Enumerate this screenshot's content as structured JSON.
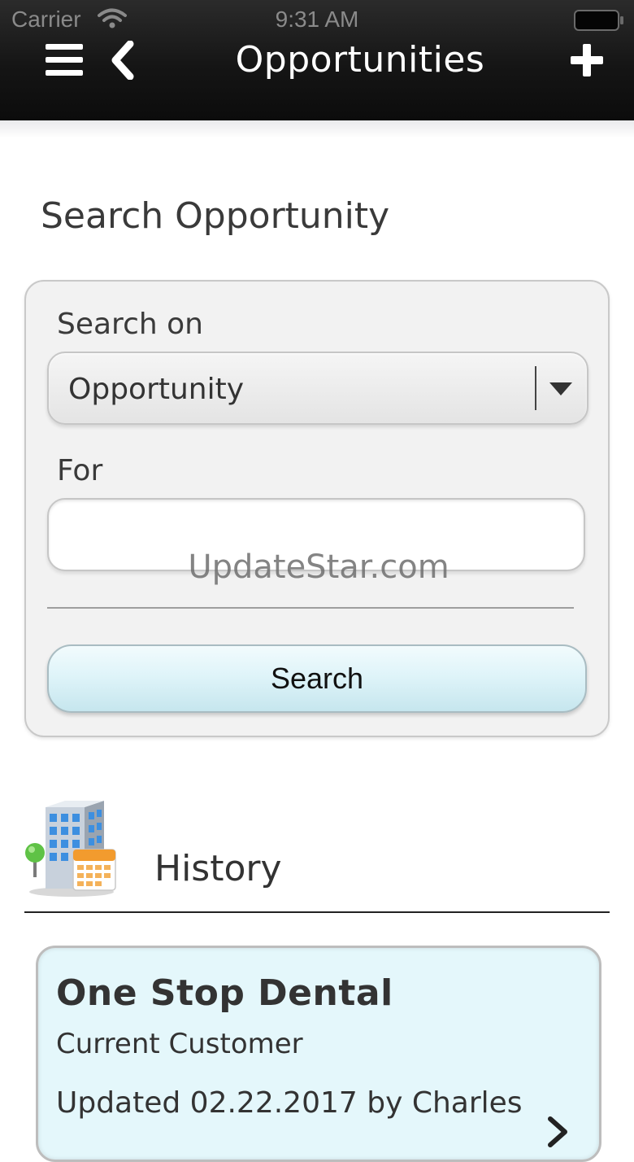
{
  "status_bar": {
    "carrier": "Carrier",
    "time": "9:31 AM"
  },
  "header": {
    "title": "Opportunities",
    "menu_icon": "hamburger-menu-icon",
    "back_icon": "chevron-left-icon",
    "add_icon": "plus-icon",
    "background": "#151515"
  },
  "search": {
    "section_title": "Search Opportunity",
    "search_on_label": "Search on",
    "search_on_value": "Opportunity",
    "for_label": "For",
    "for_value": "",
    "button_label": "Search",
    "button_color": "#dff4f9"
  },
  "watermark": "UpdateStar.com",
  "history": {
    "title": "History",
    "icon": "building-calendar-icon",
    "items": [
      {
        "name": "One Stop Dental",
        "status": "Current Customer",
        "updated": "Updated 02.22.2017 by Charles",
        "background": "#e4f7fb"
      }
    ]
  }
}
